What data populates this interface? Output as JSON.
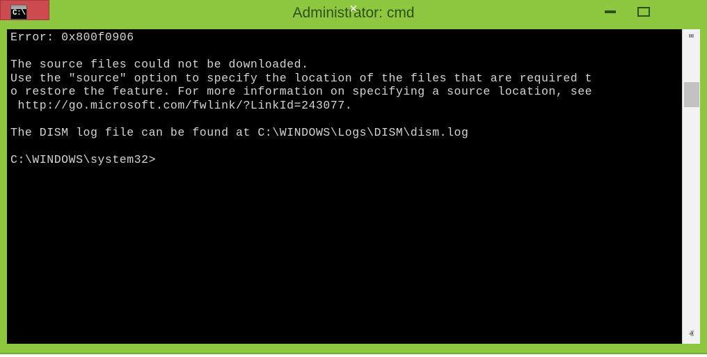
{
  "window": {
    "title": "Administrator: cmd",
    "icon_name": "cmd-console-icon",
    "icon_text": "C:\\.",
    "chrome_color": "#8dc73f",
    "title_color": "#2e4f16",
    "close_button_color": "#cd4a4f"
  },
  "titlebar": {
    "minimize_glyph": "",
    "maximize_glyph": "",
    "close_glyph": "×"
  },
  "console": {
    "background": "#000000",
    "foreground": "#d4d4d4",
    "lines": [
      "Error: 0x800f0906",
      "",
      "The source files could not be downloaded.",
      "Use the \"source\" option to specify the location of the files that are required t",
      "o restore the feature. For more information on specifying a source location, see",
      " http://go.microsoft.com/fwlink/?LinkId=243077.",
      "",
      "The DISM log file can be found at C:\\WINDOWS\\Logs\\DISM\\dism.log",
      "",
      "C:\\WINDOWS\\system32>"
    ],
    "error_code": "0x800f0906",
    "log_path": "C:\\WINDOWS\\Logs\\DISM\\dism.log",
    "help_url": "http://go.microsoft.com/fwlink/?LinkId=243077",
    "prompt": "C:\\WINDOWS\\system32>"
  },
  "scrollbar": {
    "up_arrow": "ⱎ",
    "down_arrow": "ⱏ",
    "thumb_color": "#c2c2c2",
    "track_color": "#f2f2f2"
  }
}
